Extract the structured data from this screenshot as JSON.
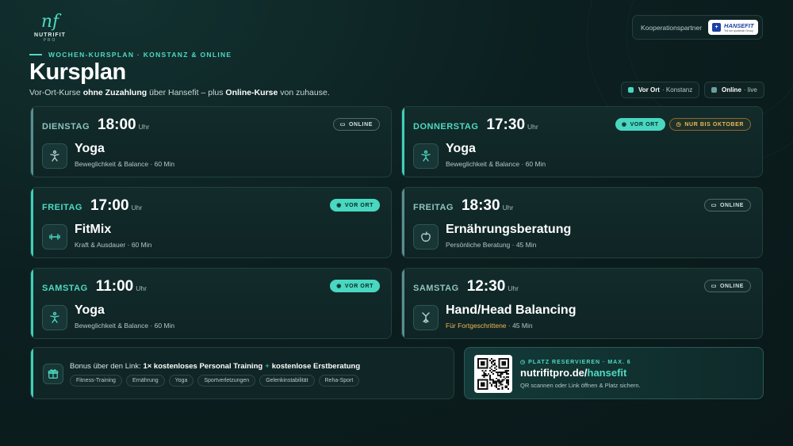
{
  "brand": {
    "mark": "nf",
    "name": "NUTRIFIT",
    "sub": "PRO"
  },
  "partner": {
    "label": "Kooperationspartner",
    "logo_name": "HANSEFIT",
    "logo_tag": "Teil der qualitrain Group"
  },
  "header": {
    "kicker": "WOCHEN-KURSPLAN · KONSTANZ & ONLINE",
    "title": "Kursplan",
    "subtitle": {
      "p1": "Vor-Ort-Kurse ",
      "b1": "ohne Zuzahlung",
      "p2": " über Hansefit – plus ",
      "b2": "Online-Kurse",
      "p3": " von zuhause."
    }
  },
  "legend": [
    {
      "label": "Vor Ort",
      "note": "· Konstanz",
      "color": "#49d7c0"
    },
    {
      "label": "Online",
      "note": "· live",
      "color": "#6a9fa0"
    }
  ],
  "colors": {
    "accent": "#4fd9c2",
    "warning": "#f0b84f",
    "background": "#0c1f20"
  },
  "uhr": "Uhr",
  "courses": [
    {
      "day": "DIENSTAG",
      "time": "18:00",
      "mode": "online",
      "badges": [
        {
          "kind": "online",
          "icon": "monitor-icon",
          "label": "ONLINE"
        }
      ],
      "icon": "yoga-figure-icon",
      "name": "Yoga",
      "desc_pre": "",
      "desc": "Beweglichkeit & Balance · 60 Min"
    },
    {
      "day": "DONNERSTAG",
      "time": "17:30",
      "mode": "vorort",
      "badges": [
        {
          "kind": "vorort",
          "icon": "location-pin-icon",
          "label": "VOR ORT"
        },
        {
          "kind": "warn",
          "icon": "clock-icon",
          "label": "NUR BIS OKTOBER"
        }
      ],
      "icon": "yoga-figure-icon",
      "name": "Yoga",
      "desc_pre": "",
      "desc": "Beweglichkeit & Balance · 60 Min"
    },
    {
      "day": "FREITAG",
      "time": "17:00",
      "mode": "vorort",
      "badges": [
        {
          "kind": "vorort",
          "icon": "location-pin-icon",
          "label": "VOR ORT"
        }
      ],
      "icon": "dumbbell-icon",
      "name": "FitMix",
      "desc_pre": "",
      "desc": "Kraft & Ausdauer · 60 Min"
    },
    {
      "day": "FREITAG",
      "time": "18:30",
      "mode": "online",
      "badges": [
        {
          "kind": "online",
          "icon": "monitor-icon",
          "label": "ONLINE"
        }
      ],
      "icon": "apple-icon",
      "name": "Ernährungsberatung",
      "desc_pre": "",
      "desc": "Persönliche Beratung · 45 Min"
    },
    {
      "day": "SAMSTAG",
      "time": "11:00",
      "mode": "vorort",
      "badges": [
        {
          "kind": "vorort",
          "icon": "location-pin-icon",
          "label": "VOR ORT"
        }
      ],
      "icon": "yoga-figure-icon",
      "name": "Yoga",
      "desc_pre": "",
      "desc": "Beweglichkeit & Balance · 60 Min"
    },
    {
      "day": "SAMSTAG",
      "time": "12:30",
      "mode": "online",
      "badges": [
        {
          "kind": "online",
          "icon": "monitor-icon",
          "label": "ONLINE"
        }
      ],
      "icon": "handstand-icon",
      "name": "Hand/Head Balancing",
      "desc_pre": "Für Fortgeschrittene",
      "desc": " · 45 Min"
    }
  ],
  "bonus": {
    "intro": "Bonus über den Link: ",
    "item1": "1× kostenloses Personal Training",
    "plus": "+",
    "item2": "kostenlose Erstberatung",
    "tags": [
      "Fitness-Training",
      "Ernährung",
      "Yoga",
      "Sportverletzungen",
      "Gelenkinstabilität",
      "Reha-Sport"
    ]
  },
  "reserve": {
    "kicker": "PLATZ RESERVIEREN · MAX. 6",
    "url_base": "nutrifitpro.de/",
    "url_path": "hansefit",
    "hint": "QR scannen oder Link öffnen & Platz sichern."
  }
}
